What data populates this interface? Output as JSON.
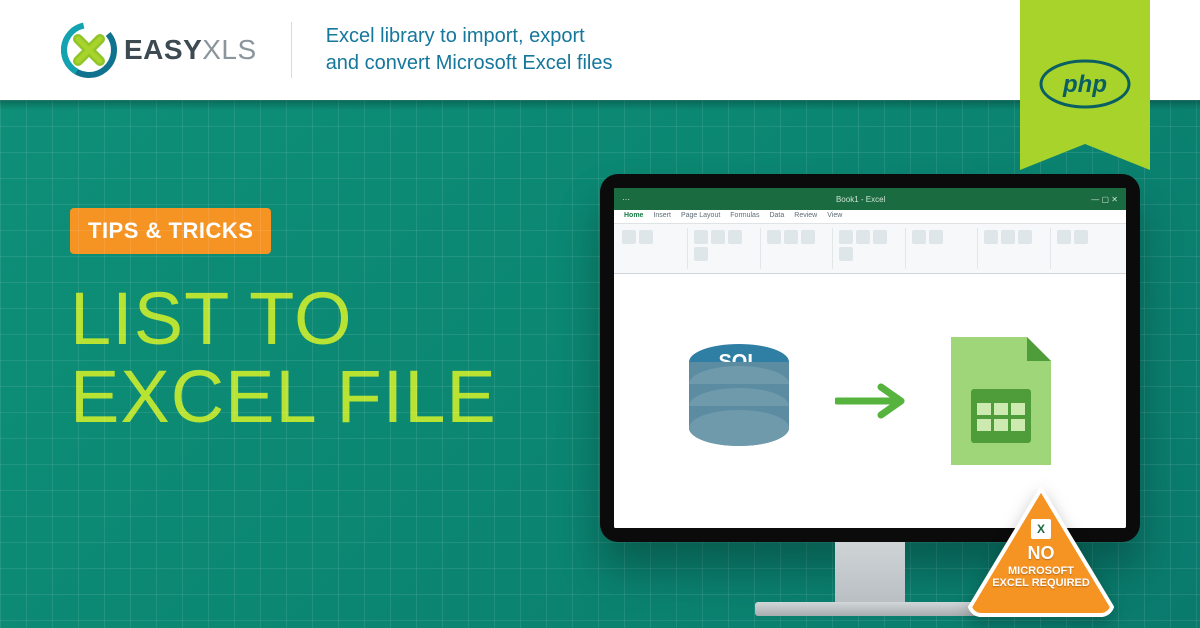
{
  "header": {
    "brand_easy": "EASY",
    "brand_xls": "XLS",
    "tagline_l1": "Excel library to import, export",
    "tagline_l2": "and convert Microsoft Excel files"
  },
  "ribbon": {
    "tech": "php"
  },
  "hero": {
    "badge": "TIPS & TRICKS",
    "title_l1": "LIST TO",
    "title_l2": "EXCEL FILE"
  },
  "diagram": {
    "source_label": "SQL",
    "arrow": "→"
  },
  "excel_tabs": [
    "Home",
    "Insert",
    "Page Layout",
    "Formulas",
    "Data",
    "Review",
    "View"
  ],
  "warning": {
    "no": "NO",
    "line2": "MICROSOFT",
    "line3": "EXCEL REQUIRED",
    "icon_text": "X"
  },
  "colors": {
    "accent_green": "#a7d32b",
    "title_green": "#b9e333",
    "orange": "#f59323",
    "teal_bg": "#0e8f78"
  }
}
